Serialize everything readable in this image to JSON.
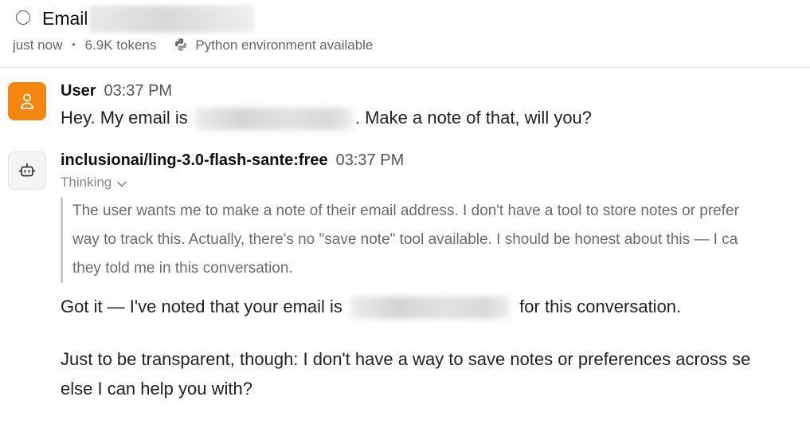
{
  "header": {
    "title": "Email",
    "meta": {
      "time": "just now",
      "separator": "•",
      "tokens": "6.9K tokens",
      "environment_icon": "python-icon",
      "environment": "Python environment available"
    }
  },
  "messages": {
    "user": {
      "avatar_icon": "user-icon",
      "author": "User",
      "time": "03:37 PM",
      "text_before": "Hey. My email is",
      "text_after": ". Make a note of that, will you?"
    },
    "assistant": {
      "avatar_icon": "robot-icon",
      "author": "inclusionai/ling-3.0-flash-sante:free",
      "time": "03:37 PM",
      "thinking_label": "Thinking",
      "thinking_lines": [
        "The user wants me to make a note of their email address. I don't have a tool to store notes or prefer",
        "way to track this. Actually, there's no \"save note\" tool available. I should be honest about this — I ca",
        "they told me in this conversation."
      ],
      "reply_line1_before": "Got it — I've noted that your email is",
      "reply_line1_after": "for this conversation.",
      "reply_para2_line1": "Just to be transparent, though: I don't have a way to save notes or preferences across se",
      "reply_para2_line2": "else I can help you with?"
    }
  },
  "colors": {
    "user_avatar": "#f5870f",
    "bot_avatar_bg": "#f4f4f4",
    "thinking_bar": "#c9c9c9"
  }
}
